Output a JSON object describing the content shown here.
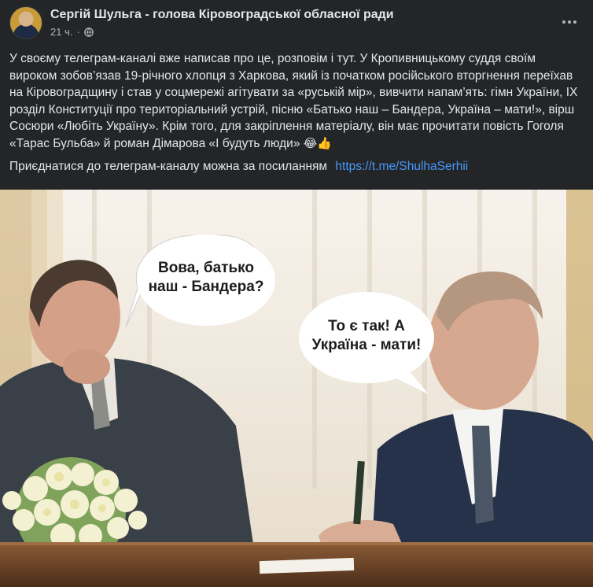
{
  "post": {
    "author": "Сергій Шульга - голова Кіровоградської обласної ради",
    "time": "21 ч.",
    "separator": "·",
    "audience_icon": "globe-icon",
    "more_icon": "more-options-icon",
    "text": {
      "paragraph1": "У своєму телеграм-каналі вже написав про це, розповім і тут. У Кропивницькому суддя своїм вироком зобов’язав 19-річного хлопця з Харкова, який із початком російського вторгнення переїхав на Кіровоградщину і став у соцмережі агітувати за «руській мір», вивчити напам’ять: гімн України, ІХ розділ Конституції про територіальний устрій, пісню «Батько наш – Бандера, Україна – мати!», вірш Сосюри «Любіть Україну». Крім того, для закріплення матеріалу, він має прочитати повість Гоголя «Тарас Бульба» й роман Дімарова «І будуть люди»",
      "emoji": "😂👍",
      "paragraph2": "Приєднатися до телеграм-каналу можна за посиланням",
      "link": "https://t.me/ShulhaSerhii"
    }
  },
  "image": {
    "bubble_left": [
      "Вова, батько",
      "наш - Бандера?"
    ],
    "bubble_right": [
      "То є так! А",
      "Україна - мати!"
    ]
  },
  "colors": {
    "background": "#242526",
    "text": "#e4e6eb",
    "secondary": "#b0b3b8",
    "link": "#4599ff"
  }
}
